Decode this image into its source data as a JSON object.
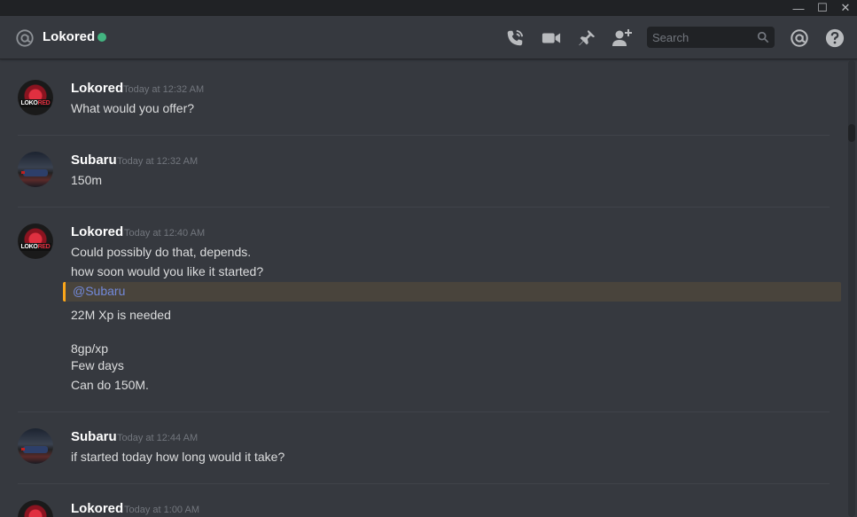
{
  "window": {
    "minimize": "—",
    "maximize": "☐",
    "close": "✕"
  },
  "header": {
    "channel_name": "Lokored",
    "status_color": "#43b581",
    "icons": [
      "call-icon",
      "video-icon",
      "pin-icon",
      "add-friend-icon",
      "mention-icon",
      "help-icon"
    ],
    "search_placeholder": "Search"
  },
  "avatar_logo": {
    "part1": "LOKO",
    "part2": "RED"
  },
  "messages": [
    {
      "author": "Lokored",
      "timestamp": "Today at 12:32 AM",
      "lines": [
        "What would you offer?"
      ]
    },
    {
      "author": "Subaru",
      "timestamp": "Today at 12:32 AM",
      "lines": [
        "150m"
      ]
    },
    {
      "author": "Lokored",
      "timestamp": "Today at 12:40 AM",
      "lines": [
        "Could possibly do that, depends.",
        "how soon would you like it started?"
      ],
      "mention": "@Subaru",
      "lines_after": [
        "22M Xp is needed",
        "8gp/xp",
        "Few days",
        "Can do 150M."
      ]
    },
    {
      "author": "Subaru",
      "timestamp": "Today at 12:44 AM",
      "lines": [
        "if started today how long would it take?"
      ]
    },
    {
      "author": "Lokored",
      "timestamp": "Today at 1:00 AM",
      "lines": []
    }
  ]
}
